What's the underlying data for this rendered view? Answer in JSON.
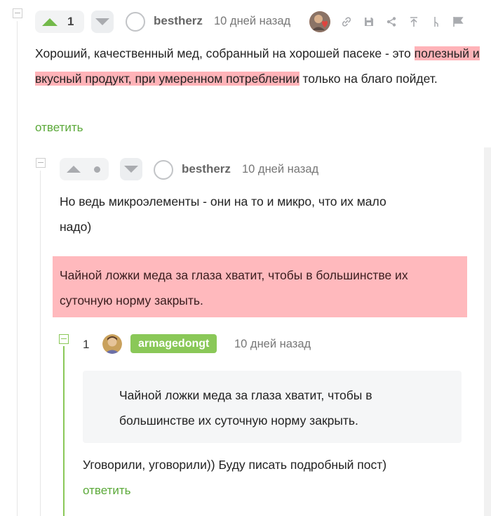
{
  "comment1": {
    "rating": "1",
    "username": "bestherz",
    "time": "10 дней назад",
    "text_before": "Хороший, качественный мед, собранный на хорошей пасеке - это ",
    "text_highlight": "полезный и вкусный продукт, при умеренном потреблении",
    "text_after": " только на благо пойдет.",
    "reply_label": "ответить",
    "tools": [
      "link-icon",
      "save-icon",
      "share-icon",
      "arrow-up-icon",
      "branch-icon",
      "flag-icon"
    ],
    "colors": {
      "upvote": "#73b94a",
      "highlight": "#ffb3b8"
    }
  },
  "comment2": {
    "username": "bestherz",
    "time": "10 дней назад",
    "paragraph1": "Но ведь микроэлементы - они на то и микро, что их мало надо)",
    "highlight_paragraph": "Чайной ложки меда за глаза хватит, чтобы в большинстве их суточную норму закрыть."
  },
  "comment3": {
    "rating": "1",
    "username": "armagedongt",
    "time": "10 дней назад",
    "quote": "Чайной ложки меда за глаза хватит, чтобы в большинстве их суточную норму закрыть.",
    "text": "Уговорили, уговорили)) Буду писать подробный пост)",
    "reply_label": "ответить",
    "colors": {
      "badge": "#8ac858",
      "reply": "#5ba939"
    }
  }
}
